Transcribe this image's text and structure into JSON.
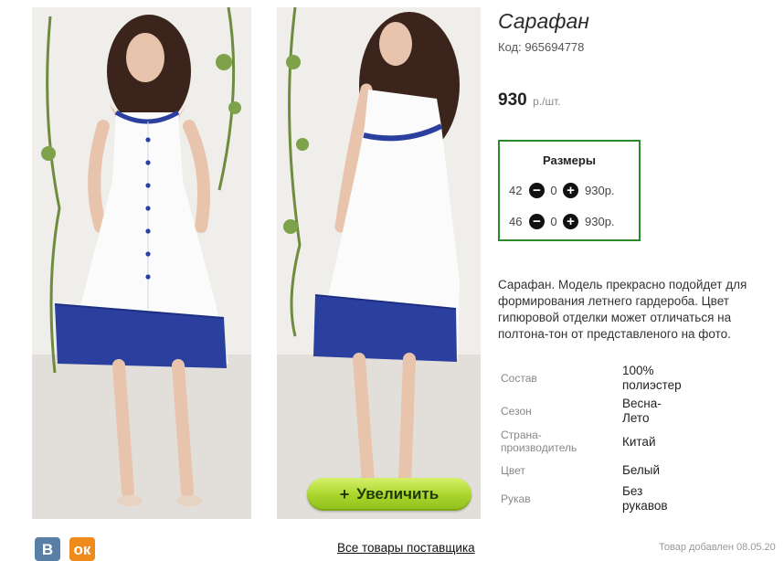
{
  "product": {
    "title": "Сарафан",
    "code": "Код: 965694778",
    "price": "930",
    "price_unit": "р./шт."
  },
  "sizes": {
    "heading": "Размеры",
    "rows": [
      {
        "size": "42",
        "qty": "0",
        "price": "930р."
      },
      {
        "size": "46",
        "qty": "0",
        "price": "930р."
      }
    ],
    "minus_icon": "minus-circle-icon",
    "plus_icon": "plus-circle-icon"
  },
  "description": "Сарафан. Модель прекрасно подойдет для формирования летнего гардероба. Цвет гипюровой отделки может отличаться на полтона-тон от представленого на фото.",
  "attributes": [
    {
      "key": "Состав",
      "value": "100% полиэстер"
    },
    {
      "key": "Сезон",
      "value": "Весна-Лето"
    },
    {
      "key": "Страна-производитель",
      "value": "Китай"
    },
    {
      "key": "Цвет",
      "value": "Белый"
    },
    {
      "key": "Рукав",
      "value": "Без рукавов"
    }
  ],
  "zoom_button": {
    "label": "Увеличить",
    "icon": "plus"
  },
  "social": {
    "vk": "В",
    "ok": "ок"
  },
  "supplier_link": "Все товары поставщика",
  "added_text": "Товар добавлен 08.05.20",
  "colors": {
    "accent_green_border": "#2a8a2a",
    "zoom_button_green": "#a8d42a",
    "vk_blue": "#5a7fa6",
    "ok_orange": "#ef8a1c",
    "lace_blue": "#2a3f9e"
  }
}
